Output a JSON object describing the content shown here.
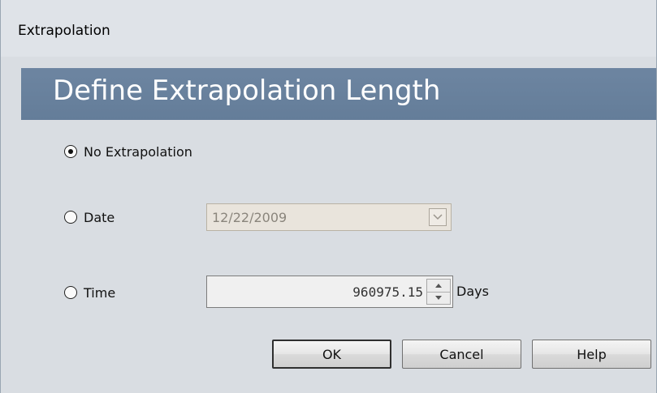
{
  "window": {
    "title": "Extrapolation"
  },
  "banner": {
    "heading": "Define Extrapolation Length"
  },
  "options": {
    "no_extrapolation": {
      "label": "No Extrapolation",
      "selected": true
    },
    "date": {
      "label": "Date",
      "selected": false,
      "value": "12/22/2009"
    },
    "time": {
      "label": "Time",
      "selected": false,
      "value": "960975.15",
      "units": "Days"
    }
  },
  "buttons": {
    "ok": "OK",
    "cancel": "Cancel",
    "help": "Help"
  },
  "icons": {
    "date_dropdown": "chevron-down-icon",
    "spin_up": "triangle-up-icon",
    "spin_down": "triangle-down-icon"
  },
  "colors": {
    "banner": "#6d85a1",
    "background": "#d9dde2",
    "disabled_field": "#e9e4dc"
  }
}
